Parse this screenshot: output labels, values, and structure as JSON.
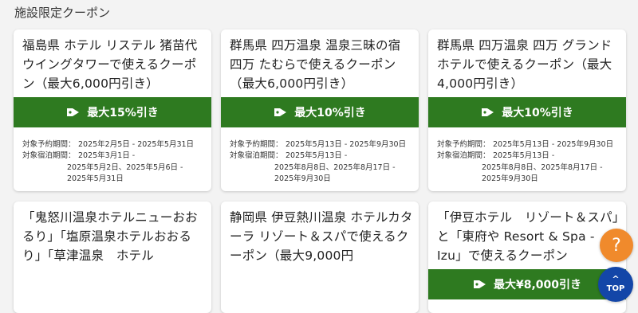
{
  "section": {
    "title": "施設限定クーポン"
  },
  "cards": [
    {
      "title": "福島県 ホテル リステル 猪苗代 ウイングタワーで使えるクーポン（最大6,000円引き）",
      "badge": "最大15%引き",
      "reserve_label": "対象予約期間：",
      "reserve_value": "2025年2月5日 - 2025年5月31日",
      "stay_label": "対象宿泊期間：",
      "stay_lines": [
        "2025年3月1日 -",
        "2025年5月2日、2025年5月6日 -",
        "2025年5月31日"
      ]
    },
    {
      "title": "群馬県 四万温泉 温泉三昧の宿 四万 たむらで使えるクーポン（最大6,000円引き）",
      "badge": "最大10%引き",
      "reserve_label": "対象予約期間：",
      "reserve_value": "2025年5月13日 - 2025年9月30日",
      "stay_label": "対象宿泊期間：",
      "stay_lines": [
        "2025年5月13日 -",
        "2025年8月8日、2025年8月17日 -",
        "2025年9月30日"
      ]
    },
    {
      "title": "群馬県 四万温泉 四万 グランド ホテルで使えるクーポン（最大4,000円引き）",
      "badge": "最大10%引き",
      "reserve_label": "対象予約期間：",
      "reserve_value": "2025年5月13日 - 2025年9月30日",
      "stay_label": "対象宿泊期間：",
      "stay_lines": [
        "2025年5月13日 -",
        "2025年8月8日、2025年8月17日 -",
        "2025年9月30日"
      ]
    },
    {
      "title": "「鬼怒川温泉ホテルニューおおるり」「塩原温泉ホテルおおるり」「草津温泉　ホテル"
    },
    {
      "title": "静岡県 伊豆熱川温泉 ホテルカターラ リゾート＆スパで使えるクーポン（最大9,000円"
    },
    {
      "title": "「伊豆ホテル　リゾート＆スパ」と「東府や Resort & Spa - Izu」で使えるクーポン",
      "badge": "最大¥8,000引き"
    }
  ],
  "help_button": {
    "label": "?"
  },
  "top_button": {
    "label": "TOP",
    "chevron": "^"
  },
  "colors": {
    "banner": "#2e7a20",
    "help": "#f08a2c",
    "top": "#1346a8"
  },
  "icons": [
    "tag-icon",
    "question-icon",
    "chevron-up-icon"
  ]
}
